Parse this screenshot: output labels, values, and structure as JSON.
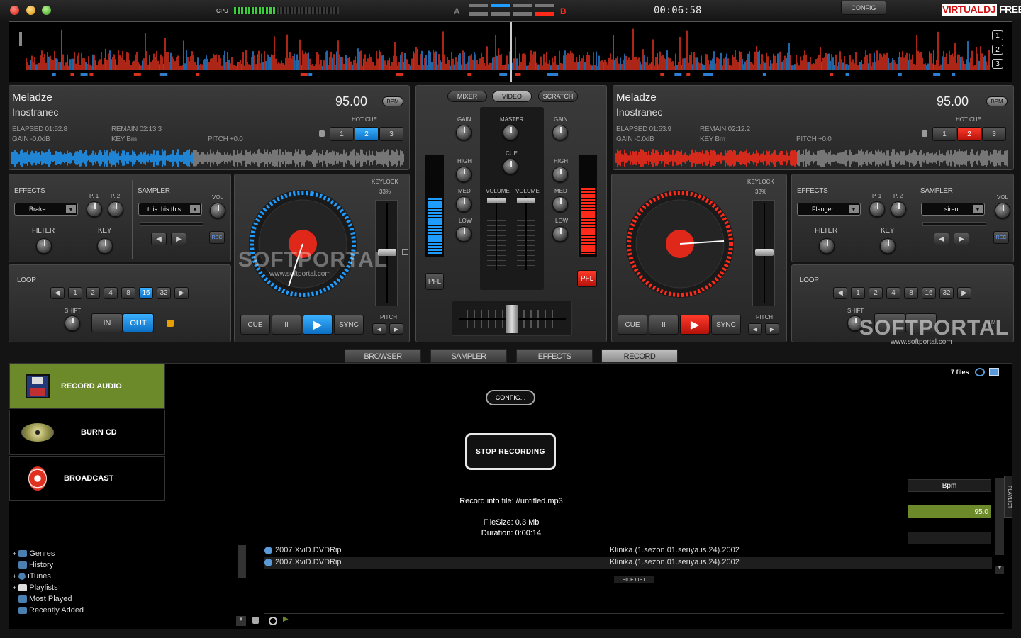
{
  "topbar": {
    "cpu_label": "CPU",
    "deck_a": "A",
    "deck_b": "B",
    "clock": "00:06:58",
    "config": "CONFIG",
    "brand_red": "VIRTUAL",
    "brand_dj": "DJ",
    "brand_free": "FREE",
    "overview_buttons": [
      "1",
      "2",
      "3"
    ]
  },
  "deck_left": {
    "title": "Meladze",
    "artist": "Inostranec",
    "bpm": "95.00",
    "bpm_badge": "BPM",
    "elapsed": "ELAPSED 01:52.8",
    "remain": "REMAIN 02:13.3",
    "gain": "GAIN -0.0dB",
    "key": "KEY Bm",
    "pitch": "PITCH +0.0",
    "hotcue_label": "HOT CUE",
    "hotcues": [
      "1",
      "2",
      "3"
    ],
    "active_hotcue": 2,
    "accent": "#1e9cff",
    "effects_label": "EFFECTS",
    "effect": "Brake",
    "p1": "P. 1",
    "p2": "P. 2",
    "sampler_label": "SAMPLER",
    "sample": "this this this",
    "vol": "VOL",
    "filter": "FILTER",
    "keyk": "KEY",
    "rec": "REC",
    "loop_label": "LOOP",
    "loop_values": [
      "1",
      "2",
      "4",
      "8",
      "16",
      "32"
    ],
    "active_loop": "16",
    "shift": "SHIFT",
    "in": "IN",
    "out": "OUT",
    "keylock": "KEYLOCK",
    "keylock_pct": "33%",
    "cue": "CUE",
    "pause": "II",
    "sync": "SYNC",
    "pitch_label": "PITCH"
  },
  "deck_right": {
    "title": "Meladze",
    "artist": "Inostranec",
    "bpm": "95.00",
    "bpm_badge": "BPM",
    "elapsed": "ELAPSED 01:53.9",
    "remain": "REMAIN 02:12.2",
    "gain": "GAIN -0.0dB",
    "key": "KEY Bm",
    "pitch": "PITCH +0.0",
    "hotcue_label": "HOT CUE",
    "hotcues": [
      "1",
      "2",
      "3"
    ],
    "active_hotcue": 2,
    "accent": "#ff2a1a",
    "effects_label": "EFFECTS",
    "effect": "Flanger",
    "p1": "P. 1",
    "p2": "P. 2",
    "sampler_label": "SAMPLER",
    "sample": "siren",
    "vol": "VOL",
    "filter": "FILTER",
    "keyk": "KEY",
    "rec": "REC",
    "loop_label": "LOOP",
    "loop_values": [
      "1",
      "2",
      "4",
      "8",
      "16",
      "32"
    ],
    "shift": "SHIFT",
    "keylock": "KEYLOCK",
    "keylock_pct": "33%",
    "cue": "CUE",
    "pause": "II",
    "sync": "SYNC",
    "pitch_label": "PITCH"
  },
  "mixer": {
    "tabs": [
      "MIXER",
      "VIDEO",
      "SCRATCH"
    ],
    "active_tab": "VIDEO",
    "gain": "GAIN",
    "master": "MASTER",
    "cue": "CUE",
    "high": "HIGH",
    "med": "MED",
    "low": "LOW",
    "volume": "VOLUME",
    "pfl": "PFL"
  },
  "watermark": {
    "brand": "SOFTPORTAL",
    "url": "www.softportal.com",
    "tm": "TM"
  },
  "bottom_tabs": [
    "BROWSER",
    "SAMPLER",
    "EFFECTS",
    "RECORD"
  ],
  "active_bottom_tab": "RECORD",
  "record_nav": [
    {
      "label": "RECORD AUDIO",
      "icon": "floppy-icon"
    },
    {
      "label": "BURN CD",
      "icon": "cd-icon"
    },
    {
      "label": "BROADCAST",
      "icon": "broadcast-icon"
    }
  ],
  "record": {
    "config": "CONFIG...",
    "stop": "STOP RECORDING",
    "file": "Record into file: //untitled.mp3",
    "filesize": "FileSize: 0.3 Mb",
    "duration": "Duration: 0:00:14"
  },
  "files_info": "7 files",
  "tree": [
    "Genres",
    "History",
    "iTunes",
    "Playlists",
    "Most Played",
    "Recently Added"
  ],
  "rows": [
    {
      "a": "2007.XviD.DVDRip",
      "b": "Klinika.(1.sezon.01.seriya.is.24).2002"
    },
    {
      "a": "2007.XviD.DVDRip",
      "b": "Klinika.(1.sezon.01.seriya.is.24).2002"
    }
  ],
  "side_list": "SIDE LIST",
  "playlist_tab": "PLAYLIST",
  "info_panel": {
    "header": "Bpm",
    "value": "95.0"
  }
}
